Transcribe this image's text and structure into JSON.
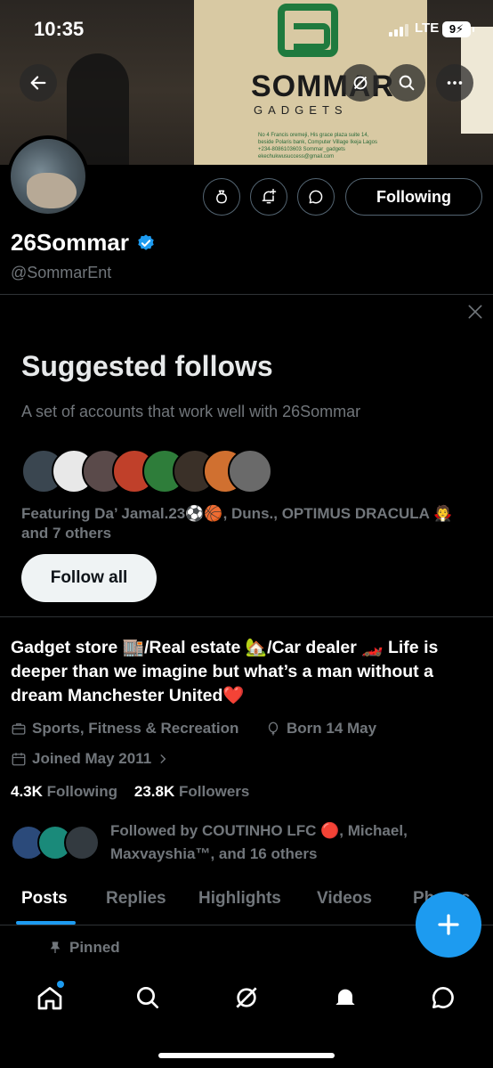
{
  "status_bar": {
    "time": "10:35",
    "network": "LTE",
    "battery": "9"
  },
  "banner": {
    "brand": "SOMMAR",
    "brand_sub": "GADGETS",
    "contact_lines": [
      "No 4 Francis oremeji, His grace plaza suite 14,",
      "beside Polaris bank, Computer Village Ikeja Lagos",
      "+234-8086103603  Sommar_gadgets",
      "ekechukwusuccess@gmail.com"
    ]
  },
  "profile": {
    "name": "26Sommar",
    "handle": "@SommarEnt",
    "follow_state_label": "Following"
  },
  "suggested": {
    "title": "Suggested follows",
    "subtitle": "A set of accounts that work well with 26Sommar",
    "featuring": "Featuring Da’ Jamal.23⚽🏀, Duns., OPTIMUS DRACULA 🧛 and 7 others",
    "follow_all_label": "Follow all",
    "face_colors": [
      "#3a4650",
      "#e8e8e8",
      "#5a4a4a",
      "#c0402a",
      "#2e7d3a",
      "#3a3028",
      "#d07030",
      "#6a6a6a"
    ]
  },
  "bio": {
    "text": "Gadget store 🏬/Real estate 🏡/Car dealer 🏎️ Life is deeper than we imagine but what’s a man without a dream Manchester United❤️",
    "category": "Sports, Fitness & Recreation",
    "born": "Born 14 May",
    "joined": "Joined May 2011"
  },
  "stats": {
    "following_count": "4.3K",
    "following_label": "Following",
    "followers_count": "23.8K",
    "followers_label": "Followers"
  },
  "followed_by": {
    "text": "Followed by COUTINHO LFC 🔴, Michael, Maxvayshia™, and 16 others",
    "colors": [
      "#2b4a7a",
      "#1a8a7a",
      "#333a40"
    ]
  },
  "tabs": [
    "Posts",
    "Replies",
    "Highlights",
    "Videos",
    "Photos"
  ],
  "pinned_label": "Pinned",
  "icons": {
    "back": "back-arrow-icon",
    "grok": "grok-icon",
    "search": "search-icon",
    "more": "more-icon",
    "money": "money-bag-icon",
    "notify": "bell-plus-icon",
    "message": "message-icon",
    "home": "home-icon",
    "explore": "search-icon",
    "notifications": "bell-icon",
    "dm": "chat-icon"
  },
  "colors": {
    "accent": "#1d9bf0",
    "muted": "#71767b",
    "divider": "#2f3336"
  }
}
